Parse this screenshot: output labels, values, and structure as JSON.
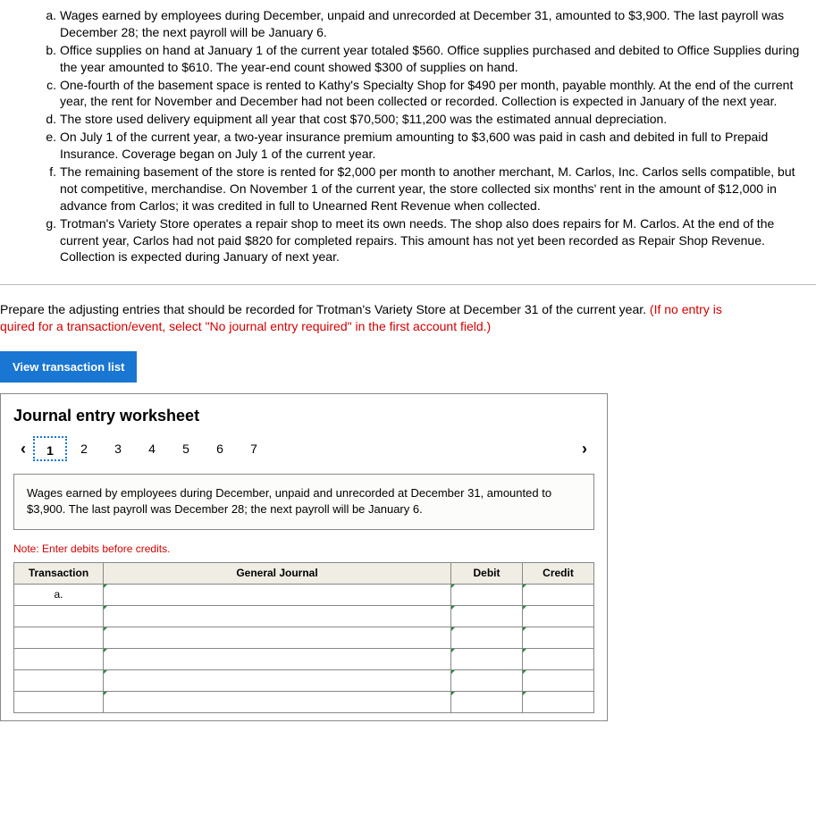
{
  "items": [
    {
      "label": "a.",
      "text": "Wages earned by employees during December, unpaid and unrecorded at December 31, amounted to $3,900. The last payroll was December 28; the next payroll will be January 6."
    },
    {
      "label": "b.",
      "text": "Office supplies on hand at January 1 of the current year totaled $560. Office supplies purchased and debited to Office Supplies during the year amounted to $610. The year-end count showed $300 of supplies on hand."
    },
    {
      "label": "c.",
      "text": "One-fourth of the basement space is rented to Kathy's Specialty Shop for $490 per month, payable monthly. At the end of the current year, the rent for November and December had not been collected or recorded. Collection is expected in January of the next year."
    },
    {
      "label": "d.",
      "text": "The store used delivery equipment all year that cost $70,500; $11,200 was the estimated annual depreciation."
    },
    {
      "label": "e.",
      "text": "On July 1 of the current year, a two-year insurance premium amounting to $3,600 was paid in cash and debited in full to Prepaid Insurance. Coverage began on July 1 of the current year."
    },
    {
      "label": "f.",
      "text": "The remaining basement of the store is rented for $2,000 per month to another merchant, M. Carlos, Inc. Carlos sells compatible, but not competitive, merchandise. On November 1 of the current year, the store collected six months' rent in the amount of $12,000 in advance from Carlos; it was credited in full to Unearned Rent Revenue when collected."
    },
    {
      "label": "g.",
      "text": "Trotman's Variety Store operates a repair shop to meet its own needs. The shop also does repairs for M. Carlos. At the end of the current year, Carlos had not paid $820 for completed repairs. This amount has not yet been recorded as Repair Shop Revenue. Collection is expected during January of next year."
    }
  ],
  "instructions": {
    "main": "Prepare the adjusting entries that should be recorded for Trotman's Variety Store at December 31 of the current year. ",
    "red": "(If no entry is",
    "red2": "quired for a transaction/event, select \"No journal entry required\" in the first account field.)"
  },
  "view_btn": "View transaction list",
  "worksheet": {
    "title": "Journal entry worksheet",
    "tabs": [
      "1",
      "2",
      "3",
      "4",
      "5",
      "6",
      "7"
    ],
    "description": "Wages earned by employees during December, unpaid and unrecorded at December 31, amounted to $3,900. The last payroll was December 28; the next payroll will be January 6.",
    "note_prefix": "Note: ",
    "note_text": "Enter debits before credits.",
    "headers": {
      "transaction": "Transaction",
      "gj": "General Journal",
      "debit": "Debit",
      "credit": "Credit"
    },
    "first_trans": "a."
  }
}
